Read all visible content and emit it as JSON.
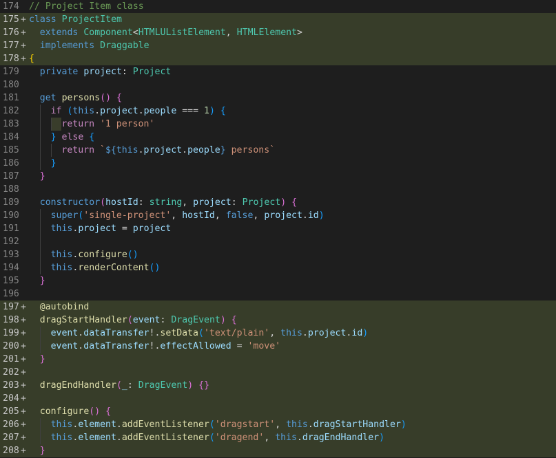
{
  "editor": {
    "lines": [
      {
        "n": "174",
        "added": false,
        "tokens": [
          {
            "c": "cm",
            "t": "// Project Item class"
          }
        ]
      },
      {
        "n": "175",
        "added": true,
        "tokens": [
          {
            "c": "kw",
            "t": "class"
          },
          {
            "c": "pl",
            "t": " "
          },
          {
            "c": "ty",
            "t": "ProjectItem"
          }
        ]
      },
      {
        "n": "176",
        "added": true,
        "indent": 1,
        "tokens": [
          {
            "c": "kw",
            "t": "extends"
          },
          {
            "c": "pl",
            "t": " "
          },
          {
            "c": "ty",
            "t": "Component"
          },
          {
            "c": "pl",
            "t": "<"
          },
          {
            "c": "ty",
            "t": "HTMLUListElement"
          },
          {
            "c": "pl",
            "t": ", "
          },
          {
            "c": "ty",
            "t": "HTMLElement"
          },
          {
            "c": "pl",
            "t": ">"
          }
        ]
      },
      {
        "n": "177",
        "added": true,
        "indent": 1,
        "tokens": [
          {
            "c": "kw",
            "t": "implements"
          },
          {
            "c": "pl",
            "t": " "
          },
          {
            "c": "ty",
            "t": "Draggable"
          }
        ]
      },
      {
        "n": "178",
        "added": true,
        "tokens": [
          {
            "c": "br1",
            "t": "{"
          }
        ]
      },
      {
        "n": "179",
        "added": false,
        "indent": 1,
        "tokens": [
          {
            "c": "kw",
            "t": "private"
          },
          {
            "c": "pl",
            "t": " "
          },
          {
            "c": "va",
            "t": "project"
          },
          {
            "c": "pl",
            "t": ": "
          },
          {
            "c": "ty",
            "t": "Project"
          }
        ]
      },
      {
        "n": "180",
        "added": false,
        "indent": 1,
        "tokens": []
      },
      {
        "n": "181",
        "added": false,
        "indent": 1,
        "tokens": [
          {
            "c": "kw",
            "t": "get"
          },
          {
            "c": "pl",
            "t": " "
          },
          {
            "c": "fn",
            "t": "persons"
          },
          {
            "c": "br2",
            "t": "()"
          },
          {
            "c": "pl",
            "t": " "
          },
          {
            "c": "br2",
            "t": "{"
          }
        ]
      },
      {
        "n": "182",
        "added": false,
        "indent": 2,
        "tokens": [
          {
            "c": "ctl",
            "t": "if"
          },
          {
            "c": "pl",
            "t": " "
          },
          {
            "c": "br3",
            "t": "("
          },
          {
            "c": "kw",
            "t": "this"
          },
          {
            "c": "pl",
            "t": "."
          },
          {
            "c": "va",
            "t": "project"
          },
          {
            "c": "pl",
            "t": "."
          },
          {
            "c": "va",
            "t": "people"
          },
          {
            "c": "pl",
            "t": " === "
          },
          {
            "c": "nu",
            "t": "1"
          },
          {
            "c": "br3",
            "t": ")"
          },
          {
            "c": "pl",
            "t": " "
          },
          {
            "c": "br3",
            "t": "{"
          }
        ]
      },
      {
        "n": "183",
        "added": false,
        "indent": 3,
        "hl": true,
        "tokens": [
          {
            "c": "ctl",
            "t": "return"
          },
          {
            "c": "pl",
            "t": " "
          },
          {
            "c": "st",
            "t": "'1 person'"
          }
        ]
      },
      {
        "n": "184",
        "added": false,
        "indent": 2,
        "tokens": [
          {
            "c": "br3",
            "t": "}"
          },
          {
            "c": "pl",
            "t": " "
          },
          {
            "c": "ctl",
            "t": "else"
          },
          {
            "c": "pl",
            "t": " "
          },
          {
            "c": "br3",
            "t": "{"
          }
        ]
      },
      {
        "n": "185",
        "added": false,
        "indent": 3,
        "tokens": [
          {
            "c": "ctl",
            "t": "return"
          },
          {
            "c": "pl",
            "t": " "
          },
          {
            "c": "st",
            "t": "`"
          },
          {
            "c": "tpl",
            "t": "${"
          },
          {
            "c": "kw",
            "t": "this"
          },
          {
            "c": "pl",
            "t": "."
          },
          {
            "c": "va",
            "t": "project"
          },
          {
            "c": "pl",
            "t": "."
          },
          {
            "c": "va",
            "t": "people"
          },
          {
            "c": "tpl",
            "t": "}"
          },
          {
            "c": "st",
            "t": " persons`"
          }
        ]
      },
      {
        "n": "186",
        "added": false,
        "indent": 2,
        "tokens": [
          {
            "c": "br3",
            "t": "}"
          }
        ]
      },
      {
        "n": "187",
        "added": false,
        "indent": 1,
        "tokens": [
          {
            "c": "br2",
            "t": "}"
          }
        ]
      },
      {
        "n": "188",
        "added": false,
        "indent": 1,
        "tokens": []
      },
      {
        "n": "189",
        "added": false,
        "indent": 1,
        "tokens": [
          {
            "c": "kw",
            "t": "constructor"
          },
          {
            "c": "br2",
            "t": "("
          },
          {
            "c": "va",
            "t": "hostId"
          },
          {
            "c": "pl",
            "t": ": "
          },
          {
            "c": "ty",
            "t": "string"
          },
          {
            "c": "pl",
            "t": ", "
          },
          {
            "c": "va",
            "t": "project"
          },
          {
            "c": "pl",
            "t": ": "
          },
          {
            "c": "ty",
            "t": "Project"
          },
          {
            "c": "br2",
            "t": ")"
          },
          {
            "c": "pl",
            "t": " "
          },
          {
            "c": "br2",
            "t": "{"
          }
        ]
      },
      {
        "n": "190",
        "added": false,
        "indent": 2,
        "tokens": [
          {
            "c": "kw",
            "t": "super"
          },
          {
            "c": "br3",
            "t": "("
          },
          {
            "c": "st",
            "t": "'single-project'"
          },
          {
            "c": "pl",
            "t": ", "
          },
          {
            "c": "va",
            "t": "hostId"
          },
          {
            "c": "pl",
            "t": ", "
          },
          {
            "c": "kw",
            "t": "false"
          },
          {
            "c": "pl",
            "t": ", "
          },
          {
            "c": "va",
            "t": "project"
          },
          {
            "c": "pl",
            "t": "."
          },
          {
            "c": "va",
            "t": "id"
          },
          {
            "c": "br3",
            "t": ")"
          }
        ]
      },
      {
        "n": "191",
        "added": false,
        "indent": 2,
        "tokens": [
          {
            "c": "kw",
            "t": "this"
          },
          {
            "c": "pl",
            "t": "."
          },
          {
            "c": "va",
            "t": "project"
          },
          {
            "c": "pl",
            "t": " = "
          },
          {
            "c": "va",
            "t": "project"
          }
        ]
      },
      {
        "n": "192",
        "added": false,
        "indent": 2,
        "tokens": []
      },
      {
        "n": "193",
        "added": false,
        "indent": 2,
        "tokens": [
          {
            "c": "kw",
            "t": "this"
          },
          {
            "c": "pl",
            "t": "."
          },
          {
            "c": "fn",
            "t": "configure"
          },
          {
            "c": "br3",
            "t": "()"
          }
        ]
      },
      {
        "n": "194",
        "added": false,
        "indent": 2,
        "tokens": [
          {
            "c": "kw",
            "t": "this"
          },
          {
            "c": "pl",
            "t": "."
          },
          {
            "c": "fn",
            "t": "renderContent"
          },
          {
            "c": "br3",
            "t": "()"
          }
        ]
      },
      {
        "n": "195",
        "added": false,
        "indent": 1,
        "tokens": [
          {
            "c": "br2",
            "t": "}"
          }
        ]
      },
      {
        "n": "196",
        "added": false,
        "indent": 1,
        "tokens": []
      },
      {
        "n": "197",
        "added": true,
        "indent": 1,
        "tokens": [
          {
            "c": "fn",
            "t": "@autobind"
          }
        ]
      },
      {
        "n": "198",
        "added": true,
        "indent": 1,
        "tokens": [
          {
            "c": "fn",
            "t": "dragStartHandler"
          },
          {
            "c": "br2",
            "t": "("
          },
          {
            "c": "va",
            "t": "event"
          },
          {
            "c": "pl",
            "t": ": "
          },
          {
            "c": "ty",
            "t": "DragEvent"
          },
          {
            "c": "br2",
            "t": ")"
          },
          {
            "c": "pl",
            "t": " "
          },
          {
            "c": "br2",
            "t": "{"
          }
        ]
      },
      {
        "n": "199",
        "added": true,
        "indent": 2,
        "tokens": [
          {
            "c": "va",
            "t": "event"
          },
          {
            "c": "pl",
            "t": "."
          },
          {
            "c": "va",
            "t": "dataTransfer"
          },
          {
            "c": "pl",
            "t": "!."
          },
          {
            "c": "fn",
            "t": "setData"
          },
          {
            "c": "br3",
            "t": "("
          },
          {
            "c": "st",
            "t": "'text/plain'"
          },
          {
            "c": "pl",
            "t": ", "
          },
          {
            "c": "kw",
            "t": "this"
          },
          {
            "c": "pl",
            "t": "."
          },
          {
            "c": "va",
            "t": "project"
          },
          {
            "c": "pl",
            "t": "."
          },
          {
            "c": "va",
            "t": "id"
          },
          {
            "c": "br3",
            "t": ")"
          }
        ]
      },
      {
        "n": "200",
        "added": true,
        "indent": 2,
        "tokens": [
          {
            "c": "va",
            "t": "event"
          },
          {
            "c": "pl",
            "t": "."
          },
          {
            "c": "va",
            "t": "dataTransfer"
          },
          {
            "c": "pl",
            "t": "!."
          },
          {
            "c": "va",
            "t": "effectAllowed"
          },
          {
            "c": "pl",
            "t": " = "
          },
          {
            "c": "st",
            "t": "'move'"
          }
        ]
      },
      {
        "n": "201",
        "added": true,
        "indent": 1,
        "tokens": [
          {
            "c": "br2",
            "t": "}"
          }
        ]
      },
      {
        "n": "202",
        "added": true,
        "indent": 1,
        "tokens": []
      },
      {
        "n": "203",
        "added": true,
        "indent": 1,
        "tokens": [
          {
            "c": "fn",
            "t": "dragEndHandler"
          },
          {
            "c": "br2",
            "t": "("
          },
          {
            "c": "va",
            "t": "_"
          },
          {
            "c": "pl",
            "t": ": "
          },
          {
            "c": "ty",
            "t": "DragEvent"
          },
          {
            "c": "br2",
            "t": ")"
          },
          {
            "c": "pl",
            "t": " "
          },
          {
            "c": "br2",
            "t": "{}"
          }
        ]
      },
      {
        "n": "204",
        "added": true,
        "indent": 1,
        "tokens": []
      },
      {
        "n": "205",
        "added": true,
        "indent": 1,
        "tokens": [
          {
            "c": "fn",
            "t": "configure"
          },
          {
            "c": "br2",
            "t": "()"
          },
          {
            "c": "pl",
            "t": " "
          },
          {
            "c": "br2",
            "t": "{"
          }
        ]
      },
      {
        "n": "206",
        "added": true,
        "indent": 2,
        "tokens": [
          {
            "c": "kw",
            "t": "this"
          },
          {
            "c": "pl",
            "t": "."
          },
          {
            "c": "va",
            "t": "element"
          },
          {
            "c": "pl",
            "t": "."
          },
          {
            "c": "fn",
            "t": "addEventListener"
          },
          {
            "c": "br3",
            "t": "("
          },
          {
            "c": "st",
            "t": "'dragstart'"
          },
          {
            "c": "pl",
            "t": ", "
          },
          {
            "c": "kw",
            "t": "this"
          },
          {
            "c": "pl",
            "t": "."
          },
          {
            "c": "va",
            "t": "dragStartHandler"
          },
          {
            "c": "br3",
            "t": ")"
          }
        ]
      },
      {
        "n": "207",
        "added": true,
        "indent": 2,
        "tokens": [
          {
            "c": "kw",
            "t": "this"
          },
          {
            "c": "pl",
            "t": "."
          },
          {
            "c": "va",
            "t": "element"
          },
          {
            "c": "pl",
            "t": "."
          },
          {
            "c": "fn",
            "t": "addEventListener"
          },
          {
            "c": "br3",
            "t": "("
          },
          {
            "c": "st",
            "t": "'dragend'"
          },
          {
            "c": "pl",
            "t": ", "
          },
          {
            "c": "kw",
            "t": "this"
          },
          {
            "c": "pl",
            "t": "."
          },
          {
            "c": "va",
            "t": "dragEndHandler"
          },
          {
            "c": "br3",
            "t": ")"
          }
        ]
      },
      {
        "n": "208",
        "added": true,
        "indent": 1,
        "tokens": [
          {
            "c": "br2",
            "t": "}"
          }
        ]
      }
    ]
  },
  "colors": {
    "background": "#1e1e1e",
    "added_line": "#373d29",
    "keyword": "#569cd6",
    "control": "#c586c0",
    "type": "#4ec9b0",
    "function": "#dcdcaa",
    "variable": "#9cdcfe",
    "string": "#ce9178",
    "number": "#b5cea8",
    "comment": "#6a9955"
  }
}
